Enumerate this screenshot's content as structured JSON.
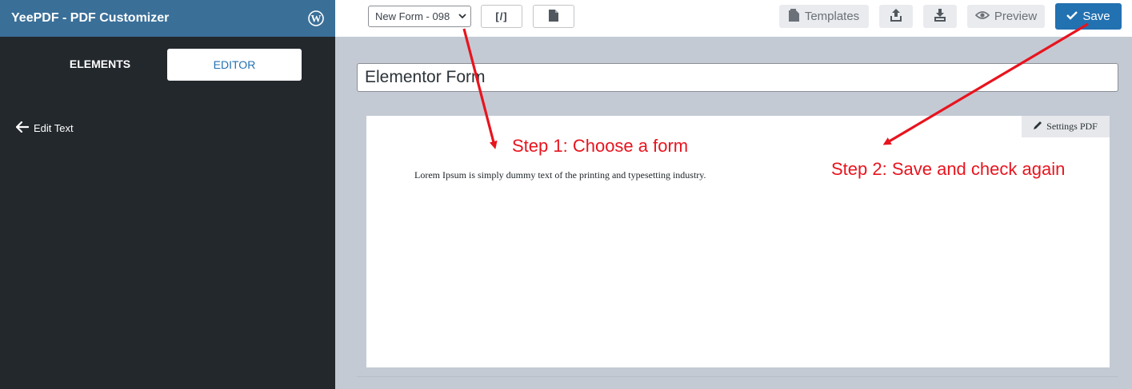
{
  "sidebar": {
    "title": "YeePDF - PDF Customizer",
    "logo_icon": "wordpress-icon",
    "tabs": [
      {
        "label": "ELEMENTS",
        "active": false
      },
      {
        "label": "EDITOR",
        "active": true
      }
    ],
    "back_label": "Edit Text"
  },
  "toolbar": {
    "form_select_value": "New Form - 098",
    "shortcode_label": "[/]",
    "templates_label": "Templates",
    "preview_label": "Preview",
    "save_label": "Save"
  },
  "editor": {
    "title_value": "Elementor Form",
    "settings_pdf_label": "Settings PDF",
    "body_text": "Lorem Ipsum is simply dummy text of the printing and typesetting industry."
  },
  "annotations": {
    "step1": "Step 1: Choose a form",
    "step2": "Step 2: Save and check again",
    "color": "#e8141e"
  },
  "colors": {
    "header_blue": "#3a6f98",
    "sidebar_dark": "#23282d",
    "primary": "#2271b1",
    "canvas_bg": "#c3cad4"
  }
}
